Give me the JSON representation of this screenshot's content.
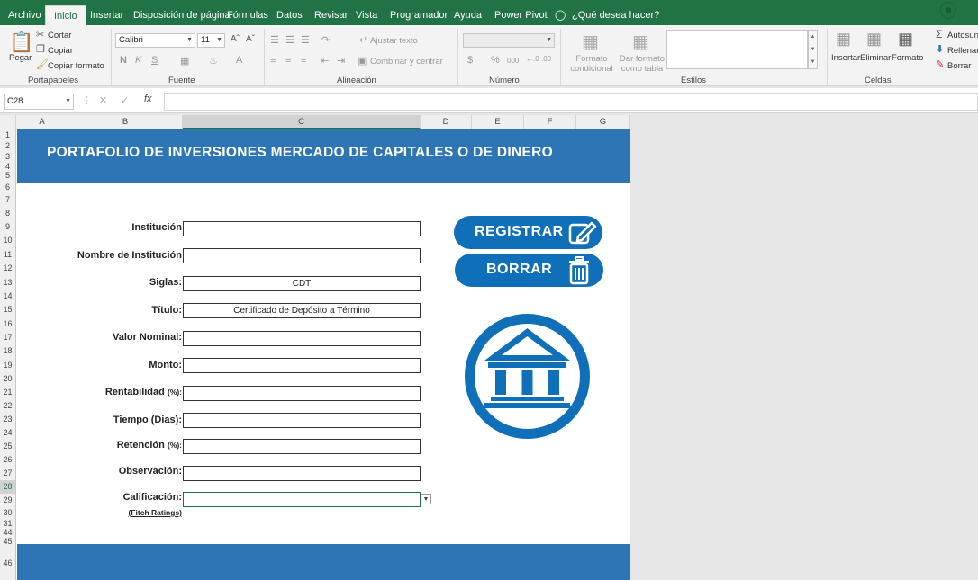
{
  "tabs": [
    "Archivo",
    "Inicio",
    "Insertar",
    "Disposición de página",
    "Fórmulas",
    "Datos",
    "Revisar",
    "Vista",
    "Programador",
    "Ayuda",
    "Power Pivot",
    "¿Qué desea hacer?"
  ],
  "active_tab": "Inicio",
  "ribbon": {
    "clipboard": {
      "paste": "Pegar",
      "cut": "Cortar",
      "copy": "Copiar",
      "format_painter": "Copiar formato",
      "label": "Portapapeles"
    },
    "font": {
      "name": "Calibri",
      "size": "11",
      "label": "Fuente"
    },
    "alignment": {
      "wrap": "Ajustar texto",
      "merge": "Combinar y centrar",
      "label": "Alineación"
    },
    "number": {
      "label": "Número"
    },
    "styles": {
      "conditional": "Formato condicional",
      "table": "Dar formato como tabla",
      "label": "Estilos"
    },
    "cells": {
      "insert": "Insertar",
      "delete": "Eliminar",
      "format": "Formato",
      "label": "Celdas"
    },
    "editing": {
      "autosum": "Autosun",
      "fill": "Rellenar",
      "clear": "Borrar"
    }
  },
  "formula_bar": {
    "name_box": "C28",
    "fx": "fx",
    "value": ""
  },
  "columns": [
    "A",
    "B",
    "C",
    "D",
    "E",
    "F",
    "G"
  ],
  "selected_column": "C",
  "rows": [
    "1",
    "2",
    "3",
    "4",
    "5",
    "6",
    "7",
    "8",
    "9",
    "10",
    "11",
    "12",
    "13",
    "14",
    "15",
    "16",
    "17",
    "18",
    "19",
    "20",
    "21",
    "22",
    "23",
    "24",
    "25",
    "26",
    "27",
    "28",
    "29",
    "30",
    "31",
    "44",
    "45",
    "46"
  ],
  "selected_row": "28",
  "form": {
    "title": "PORTAFOLIO DE INVERSIONES MERCADO DE CAPITALES O DE DINERO",
    "fields": [
      {
        "label": "Institución",
        "value": ""
      },
      {
        "label": "Nombre de Institución",
        "value": ""
      },
      {
        "label": "Siglas:",
        "value": "CDT"
      },
      {
        "label": "Título:",
        "value": "Certificado de Depósito a Término"
      },
      {
        "label": "Valor Nominal:",
        "value": ""
      },
      {
        "label": "Monto:",
        "value": ""
      },
      {
        "label": "Rentabilidad",
        "suffix": "(%):",
        "value": ""
      },
      {
        "label": "Tiempo (Dias):",
        "value": ""
      },
      {
        "label": "Retención",
        "suffix": "(%):",
        "value": ""
      },
      {
        "label": "Observación:",
        "value": ""
      },
      {
        "label": "Calificación:",
        "value": ""
      }
    ],
    "rating_note": "(Fitch Ratings)",
    "register_button": "REGISTRAR",
    "clear_button": "BORRAR"
  },
  "colors": {
    "excel_green": "#217346",
    "banner_blue": "#2e75b6",
    "button_blue": "#0f6fb8"
  }
}
